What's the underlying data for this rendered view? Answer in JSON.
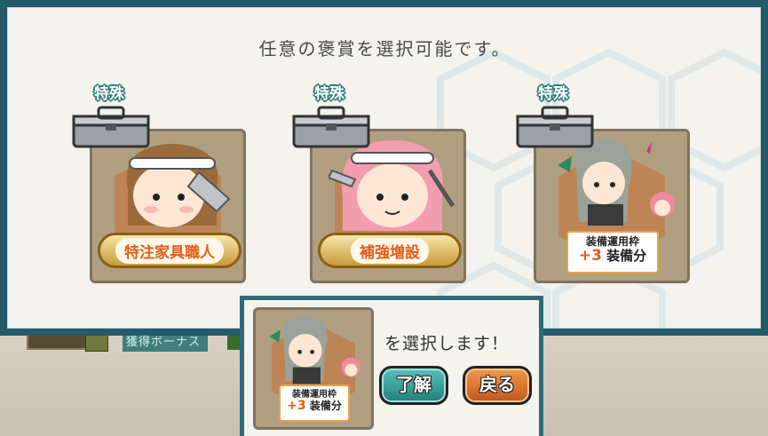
{
  "panel": {
    "title": "任意の褒賞を選択可能です。"
  },
  "rewards": [
    {
      "tag": "特殊",
      "label": "特注家具職人",
      "type": "gold-label"
    },
    {
      "tag": "特殊",
      "label": "補強増設",
      "type": "gold-label"
    },
    {
      "tag": "特殊",
      "label_line1": "装備運用枠",
      "label_plus": "+3",
      "label_line2": "装備分",
      "type": "equip-label"
    }
  ],
  "background": {
    "bonus_label": "獲得ボーナス"
  },
  "dialog": {
    "selected": {
      "label_line1": "装備運用枠",
      "label_plus": "+3",
      "label_line2": "装備分"
    },
    "confirm_text": "を選択します！",
    "ok_label": "了解",
    "back_label": "戻る"
  },
  "colors": {
    "frame": "#245b6a",
    "panel_bg": "#f4f3ed",
    "ok_button": "#2f9a95",
    "back_button": "#d86a28",
    "label_text": "#e35d17"
  }
}
